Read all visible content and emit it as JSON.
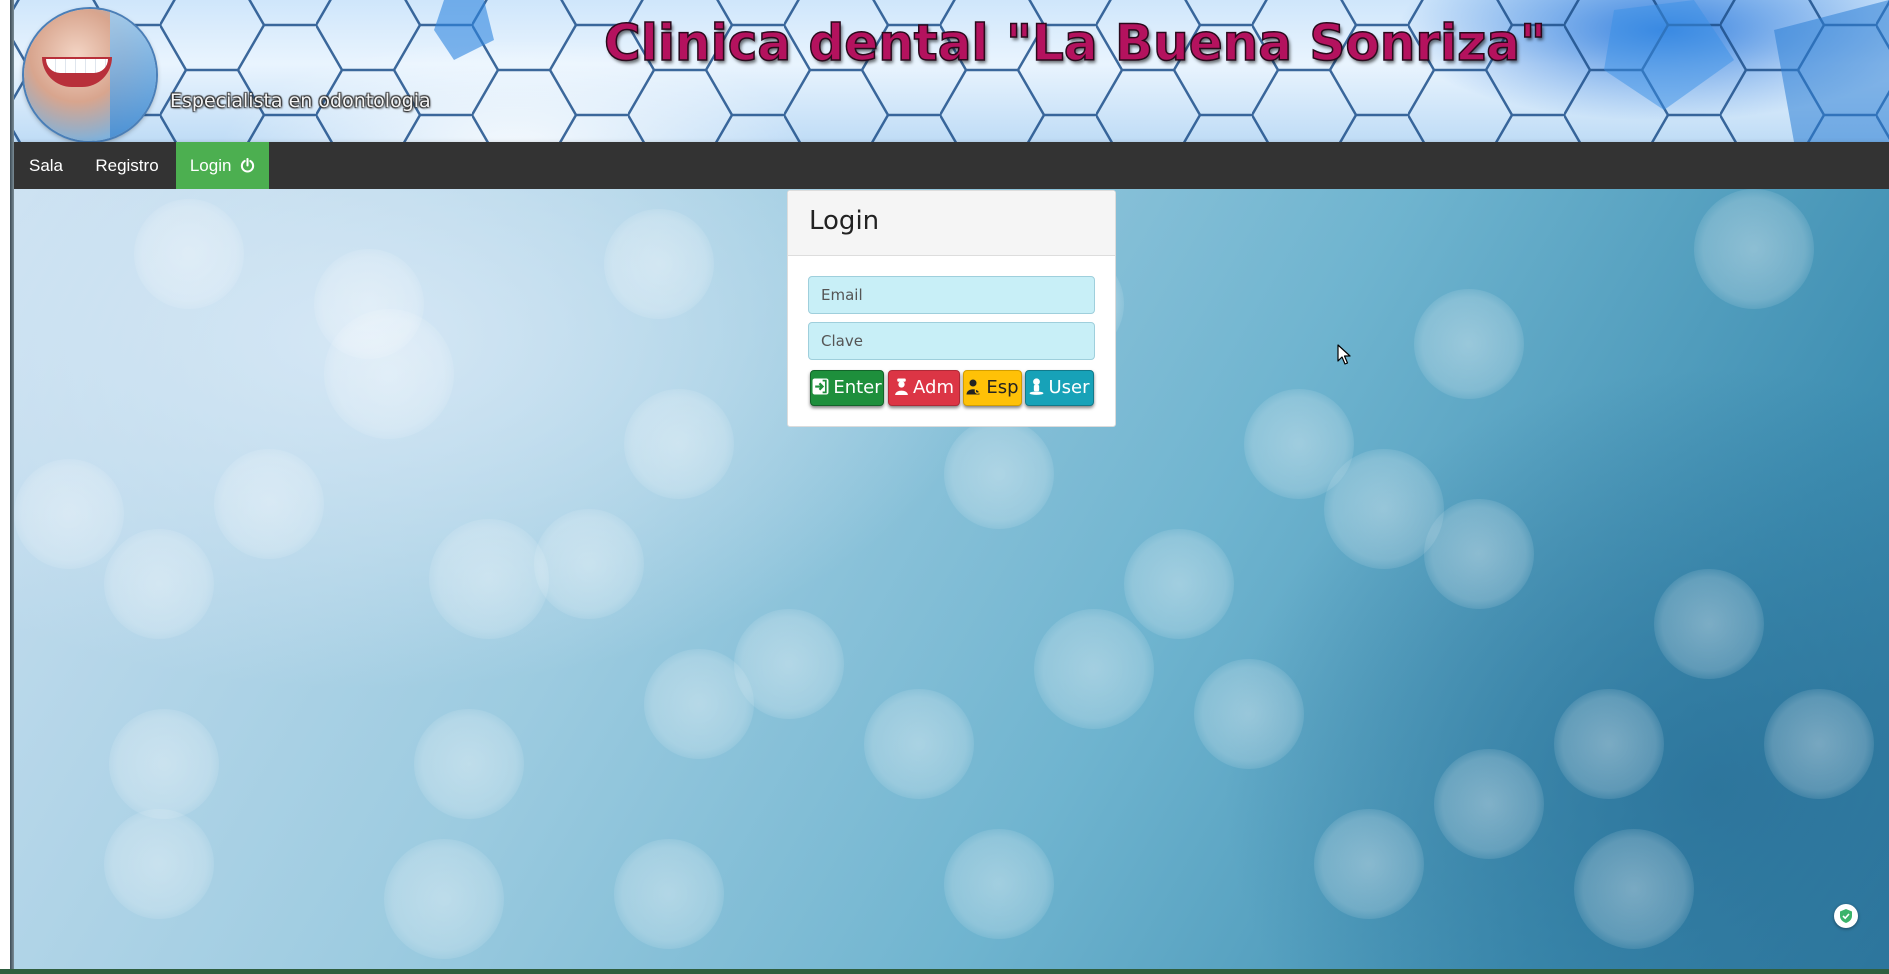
{
  "header": {
    "title": "Clinica dental \"La Buena Sonriza\"",
    "subtitle": "Especialista en odontologia",
    "logo_icon": "smile-logo-icon"
  },
  "navbar": {
    "items": [
      {
        "label": "Sala",
        "active": false
      },
      {
        "label": "Registro",
        "active": false
      },
      {
        "label": "Login",
        "active": true,
        "icon": "power-icon"
      }
    ],
    "active_color": "#4caf50",
    "bar_color": "#333333"
  },
  "login": {
    "title": "Login",
    "email_placeholder": "Email",
    "password_placeholder": "Clave",
    "buttons": {
      "enter": {
        "label": "Enter",
        "icon": "sign-in-icon",
        "color": "#1e8f3c"
      },
      "adm": {
        "label": "Adm",
        "icon": "admin-user-icon",
        "color": "#dc3545"
      },
      "esp": {
        "label": "Esp",
        "icon": "specialist-user-icon",
        "color": "#ffc107"
      },
      "user": {
        "label": "User",
        "icon": "user-icon",
        "color": "#17a2b8"
      }
    }
  },
  "overlay": {
    "shield_icon": "shield-check-icon"
  }
}
